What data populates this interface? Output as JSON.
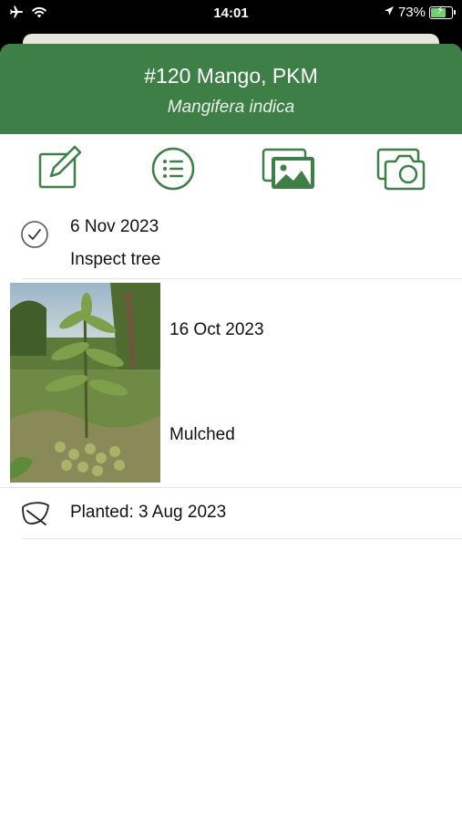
{
  "status_bar": {
    "time": "14:01",
    "battery_percent": "73%",
    "battery_level": 0.73,
    "icons": [
      "airplane-icon",
      "wifi-icon",
      "location-arrow-icon",
      "battery-charging-icon"
    ]
  },
  "header": {
    "title": "#120 Mango, PKM",
    "subtitle": "Mangifera indica",
    "background_color": "#3d7f46"
  },
  "toolbar": {
    "icons": [
      "edit-icon",
      "list-icon",
      "gallery-icon",
      "camera-icon"
    ],
    "accent_color": "#3d7f46"
  },
  "entries": [
    {
      "type": "task",
      "icon": "checkmark-circle-icon",
      "date": "6 Nov 2023",
      "text": "Inspect tree"
    },
    {
      "type": "photo",
      "image": "mango-tree-photo",
      "date": "16 Oct 2023",
      "text": "Mulched"
    },
    {
      "type": "planted",
      "icon": "leaf-icon",
      "text": "Planted: 3 Aug 2023"
    }
  ]
}
